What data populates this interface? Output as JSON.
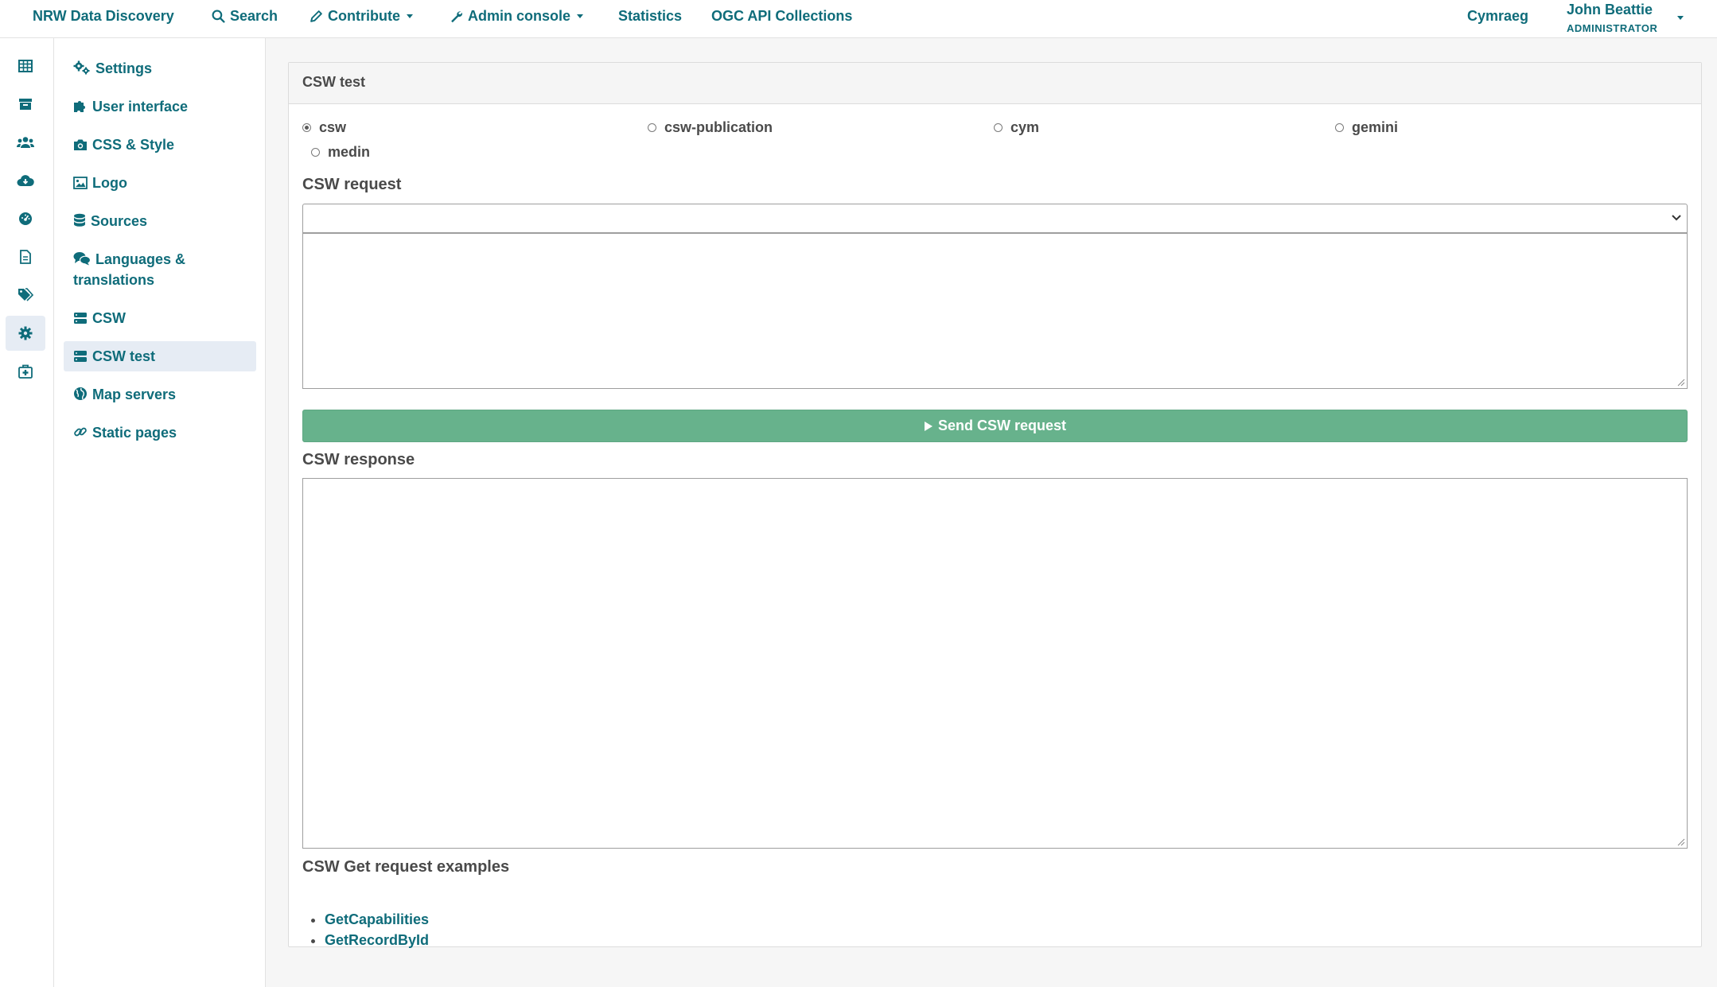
{
  "topnav": {
    "brand": "NRW Data Discovery",
    "search": "Search",
    "contribute": "Contribute",
    "admin_console": "Admin console",
    "statistics": "Statistics",
    "ogc": "OGC API Collections",
    "language": "Cymraeg",
    "user_name": "John Beattie",
    "user_role": "ADMINISTRATOR"
  },
  "icon_rail": [
    "table-icon",
    "archive-icon",
    "users-icon",
    "cloud-download-icon",
    "dashboard-icon",
    "file-icon",
    "tags-icon",
    "gear-icon",
    "medkit-icon"
  ],
  "sidebar": {
    "items": [
      {
        "label": "Settings",
        "icon": "cogs-icon"
      },
      {
        "label": "User interface",
        "icon": "puzzle-icon"
      },
      {
        "label": "CSS & Style",
        "icon": "camera-icon"
      },
      {
        "label": "Logo",
        "icon": "image-icon"
      },
      {
        "label": "Sources",
        "icon": "database-icon"
      },
      {
        "label": "Languages & translations",
        "icon": "comments-icon"
      },
      {
        "label": "CSW",
        "icon": "server-icon"
      },
      {
        "label": "CSW test",
        "icon": "server-icon",
        "active": true
      },
      {
        "label": "Map servers",
        "icon": "globe-icon"
      },
      {
        "label": "Static pages",
        "icon": "link-icon"
      }
    ]
  },
  "panel": {
    "title": "CSW test",
    "radios": [
      {
        "label": "csw",
        "checked": true
      },
      {
        "label": "csw-publication",
        "checked": false
      },
      {
        "label": "cym",
        "checked": false
      },
      {
        "label": "gemini",
        "checked": false
      },
      {
        "label": "medin",
        "checked": false
      }
    ],
    "request_label": "CSW request",
    "select_value": "",
    "request_body": "",
    "send_button": "Send CSW request",
    "response_label": "CSW response",
    "response_body": "",
    "examples_label": "CSW Get request examples",
    "examples": [
      "GetCapabilities",
      "GetRecordById"
    ]
  },
  "colors": {
    "link": "#0f6c7a",
    "send_button": "#67b28c",
    "active_background": "#e6ecf4"
  }
}
